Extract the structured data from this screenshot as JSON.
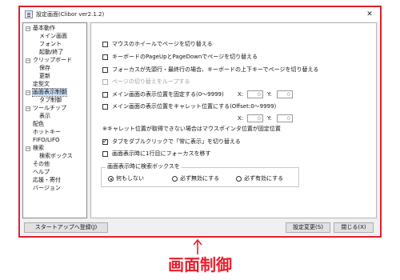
{
  "window": {
    "title": "設定画面(Clibor ver2.1.2)",
    "close_glyph": "✕"
  },
  "tree": {
    "items": [
      {
        "label": "基本動作",
        "toggle": "−"
      },
      {
        "label": "メイン画面"
      },
      {
        "label": "フォント"
      },
      {
        "label": "起動/終了"
      },
      {
        "label": "クリップボード",
        "toggle": "−"
      },
      {
        "label": "保存"
      },
      {
        "label": "更新"
      },
      {
        "label": "定型文"
      },
      {
        "label": "画面表示制御",
        "toggle": "−",
        "selected": true
      },
      {
        "label": "タブ制御"
      },
      {
        "label": "ツールチップ",
        "toggle": "−"
      },
      {
        "label": "表示"
      },
      {
        "label": "配色"
      },
      {
        "label": "ホットキー"
      },
      {
        "label": "FIFO/LIFO"
      },
      {
        "label": "検索",
        "toggle": "−"
      },
      {
        "label": "検索ボックス"
      },
      {
        "label": "その他"
      },
      {
        "label": "ヘルプ"
      },
      {
        "label": "応援・寄付"
      },
      {
        "label": "バージョン"
      }
    ]
  },
  "options": [
    {
      "label": "マウスのホイールでページを切り替える",
      "checked": false,
      "enabled": true
    },
    {
      "label": "キーボードのPageUpとPageDownでページを切り替える",
      "checked": false,
      "enabled": true
    },
    {
      "label": "フォーカスが先頭行・最終行の場合、キーボードの上下キーでページを切り替える",
      "checked": false,
      "enabled": true
    },
    {
      "label": "ページの切り替えをループする",
      "checked": false,
      "enabled": false
    },
    {
      "label": "メイン画面の表示位置を固定する(0〜9999)",
      "checked": false,
      "enabled": true
    },
    {
      "label": "メイン画面の表示位置をキャレット位置にする(Offset:0〜9999)",
      "checked": false,
      "enabled": true
    },
    {
      "label": "タブをダブルクリックで「常に表示」を切り替える",
      "checked": true,
      "enabled": true
    },
    {
      "label": "画面表示時に1行目にフォーカスを移す",
      "checked": false,
      "enabled": true
    }
  ],
  "fixed_position": {
    "x_label": "X:",
    "x_value": "0",
    "y_label": "Y:",
    "y_value": "0"
  },
  "caret_position": {
    "x_label": "X:",
    "x_value": "0",
    "y_label": "Y:",
    "y_value": "0"
  },
  "caret_note": "※キャレット位置が取得できない場合はマウスポインタ位置が固定位置",
  "search_box_group": {
    "title": "画面表示時に検索ボックスを",
    "radios": [
      {
        "label": "何もしない",
        "selected": true
      },
      {
        "label": "必ず無効にする",
        "selected": false
      },
      {
        "label": "必ず有効にする",
        "selected": false
      }
    ]
  },
  "buttons": {
    "startup": "スタートアップへ登録(J)",
    "apply": "設定変更(S)",
    "close": "閉じる(X)"
  },
  "annotation": {
    "caption": "画面制御",
    "color": "#e8202c"
  }
}
